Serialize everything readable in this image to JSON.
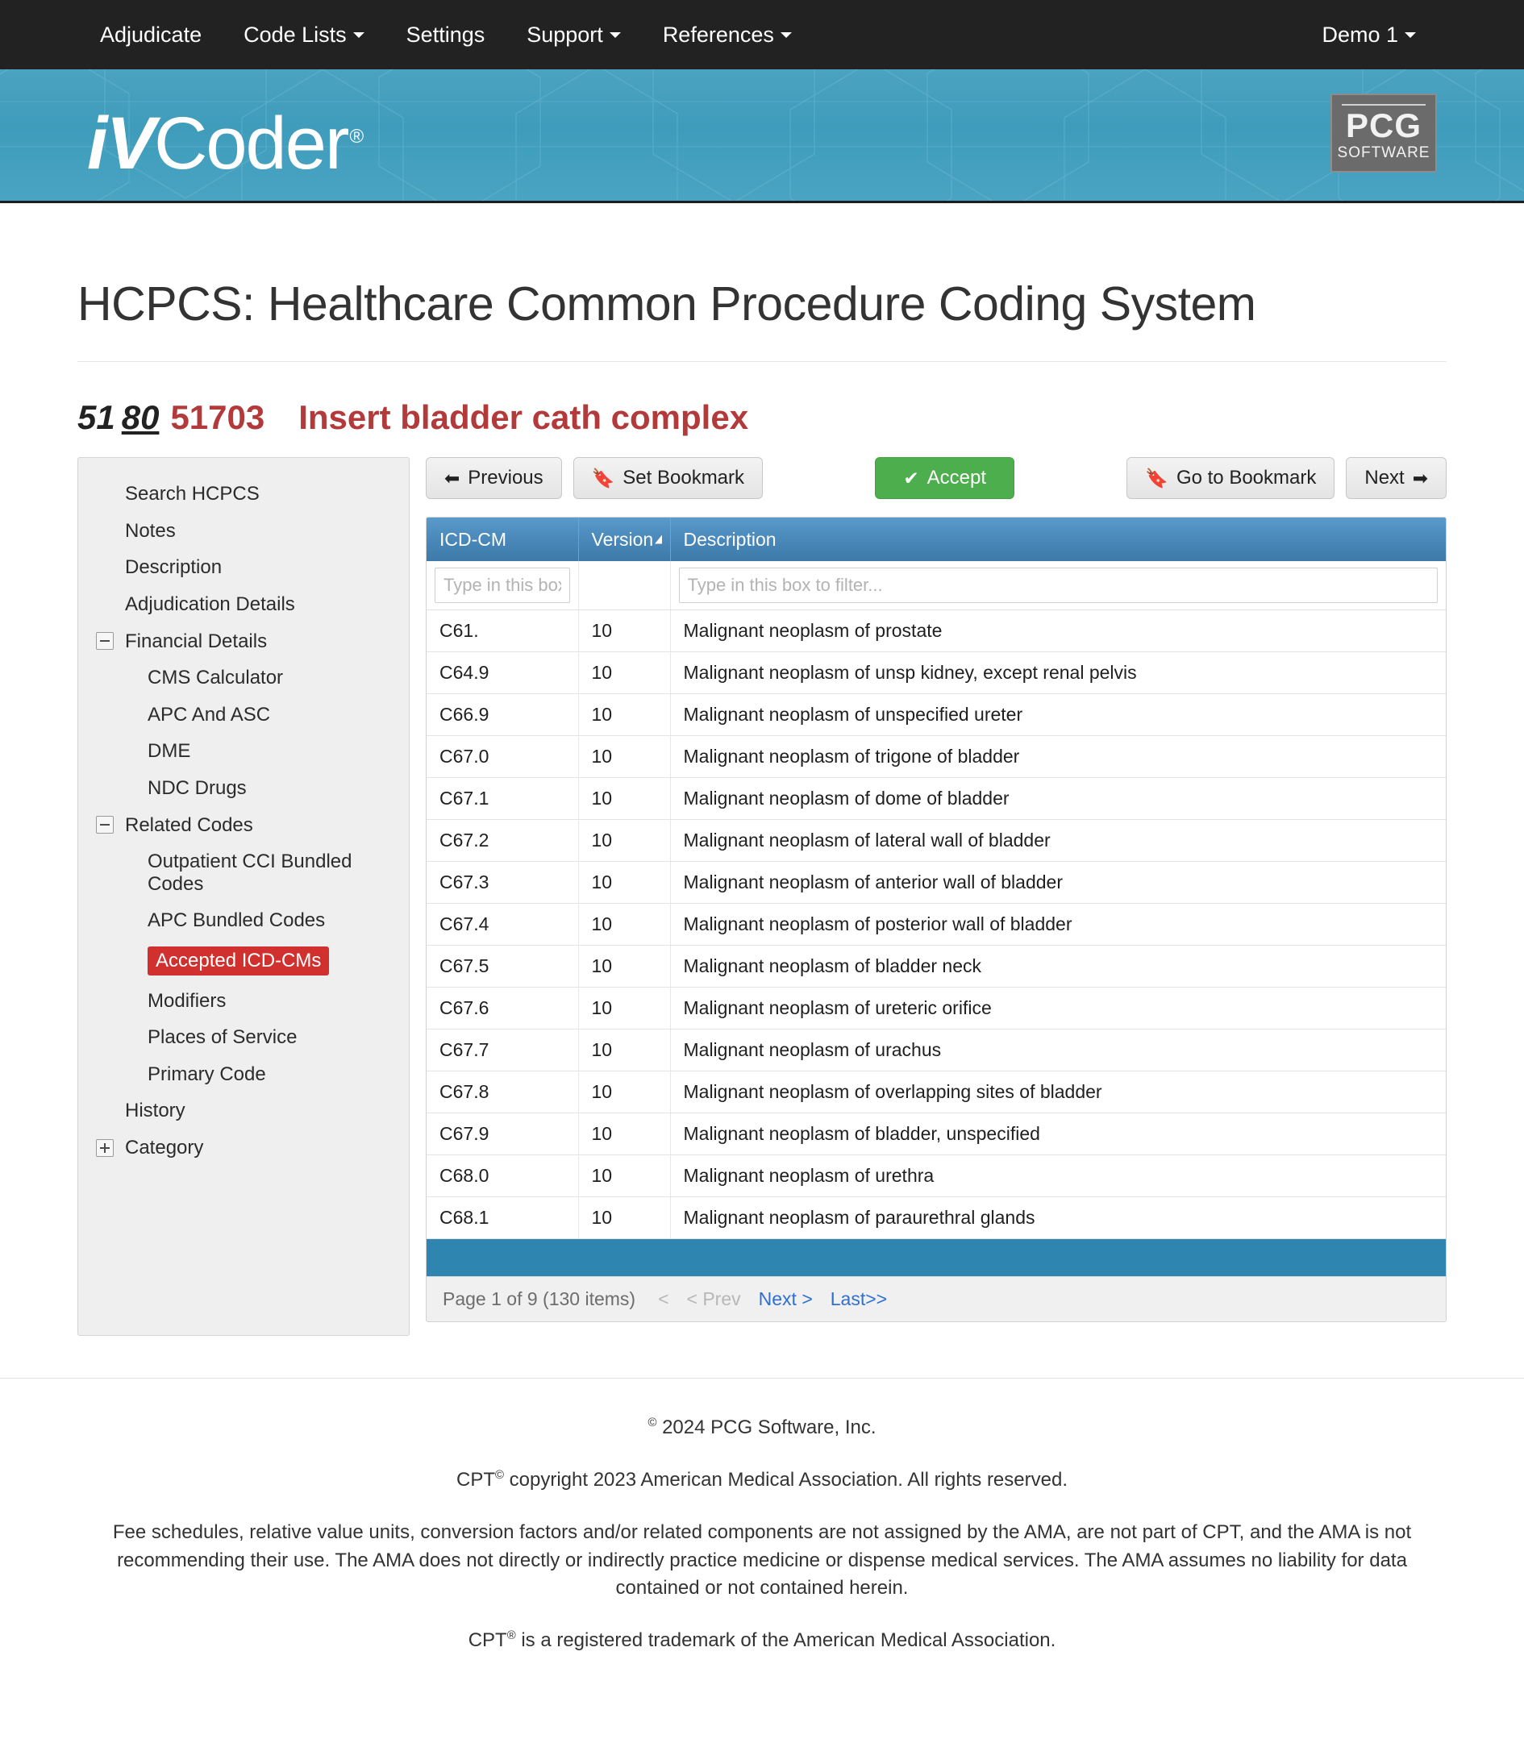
{
  "nav": {
    "items": [
      {
        "label": "Adjudicate",
        "caret": false
      },
      {
        "label": "Code Lists",
        "caret": true
      },
      {
        "label": "Settings",
        "caret": false
      },
      {
        "label": "Support",
        "caret": true
      },
      {
        "label": "References",
        "caret": true
      }
    ],
    "user": {
      "label": "Demo 1",
      "caret": true
    }
  },
  "brand": {
    "logo_i": "i",
    "logo_v": "V",
    "logo_rest": "Coder",
    "registered": "®",
    "pcg_main": "PCG",
    "pcg_sub": "SOFTWARE"
  },
  "page": {
    "title": "HCPCS: Healthcare Common Procedure Coding System",
    "code_modifier_1": "51",
    "code_modifier_2": "80",
    "code_number": "51703",
    "code_description": "Insert bladder cath complex"
  },
  "sidebar": {
    "items": [
      {
        "label": "Search HCPCS",
        "level": 0,
        "twisty": "none",
        "active": false
      },
      {
        "label": "Notes",
        "level": 0,
        "twisty": "none",
        "active": false
      },
      {
        "label": "Description",
        "level": 0,
        "twisty": "none",
        "active": false
      },
      {
        "label": "Adjudication Details",
        "level": 0,
        "twisty": "none",
        "active": false
      },
      {
        "label": "Financial Details",
        "level": 0,
        "twisty": "minus",
        "active": false
      },
      {
        "label": "CMS Calculator",
        "level": 1,
        "twisty": "none",
        "active": false
      },
      {
        "label": "APC And ASC",
        "level": 1,
        "twisty": "none",
        "active": false
      },
      {
        "label": "DME",
        "level": 1,
        "twisty": "none",
        "active": false
      },
      {
        "label": "NDC Drugs",
        "level": 1,
        "twisty": "none",
        "active": false
      },
      {
        "label": "Related Codes",
        "level": 0,
        "twisty": "minus",
        "active": false
      },
      {
        "label": "Outpatient CCI Bundled Codes",
        "level": 1,
        "twisty": "none",
        "active": false
      },
      {
        "label": "APC Bundled Codes",
        "level": 1,
        "twisty": "none",
        "active": false
      },
      {
        "label": "Accepted ICD-CMs",
        "level": 1,
        "twisty": "none",
        "active": true
      },
      {
        "label": "Modifiers",
        "level": 1,
        "twisty": "none",
        "active": false
      },
      {
        "label": "Places of Service",
        "level": 1,
        "twisty": "none",
        "active": false
      },
      {
        "label": "Primary Code",
        "level": 1,
        "twisty": "none",
        "active": false
      },
      {
        "label": "History",
        "level": 0,
        "twisty": "none",
        "active": false
      },
      {
        "label": "Category",
        "level": 0,
        "twisty": "plus",
        "active": false
      }
    ]
  },
  "toolbar": {
    "previous_label": "Previous",
    "previous_icon": "arrow-left-icon",
    "set_bookmark_label": "Set Bookmark",
    "set_bookmark_icon": "bookmark-icon",
    "accept_label": "Accept",
    "accept_icon": "check-icon",
    "go_to_bookmark_label": "Go to Bookmark",
    "go_to_bookmark_icon": "bookmark-flag-icon",
    "next_label": "Next",
    "next_icon": "arrow-right-icon",
    "accept_color": "#4cae4c"
  },
  "grid": {
    "columns": [
      {
        "label": "ICD-CM",
        "sorted": false
      },
      {
        "label": "Version",
        "sorted": true
      },
      {
        "label": "Description",
        "sorted": false
      }
    ],
    "filters": {
      "icd_placeholder": "Type in this box",
      "version_placeholder": "",
      "description_placeholder": "Type in this box to filter..."
    },
    "rows": [
      {
        "code": "C61.",
        "version": "10",
        "description": "Malignant neoplasm of prostate"
      },
      {
        "code": "C64.9",
        "version": "10",
        "description": "Malignant neoplasm of unsp kidney, except renal pelvis"
      },
      {
        "code": "C66.9",
        "version": "10",
        "description": "Malignant neoplasm of unspecified ureter"
      },
      {
        "code": "C67.0",
        "version": "10",
        "description": "Malignant neoplasm of trigone of bladder"
      },
      {
        "code": "C67.1",
        "version": "10",
        "description": "Malignant neoplasm of dome of bladder"
      },
      {
        "code": "C67.2",
        "version": "10",
        "description": "Malignant neoplasm of lateral wall of bladder"
      },
      {
        "code": "C67.3",
        "version": "10",
        "description": "Malignant neoplasm of anterior wall of bladder"
      },
      {
        "code": "C67.4",
        "version": "10",
        "description": "Malignant neoplasm of posterior wall of bladder"
      },
      {
        "code": "C67.5",
        "version": "10",
        "description": "Malignant neoplasm of bladder neck"
      },
      {
        "code": "C67.6",
        "version": "10",
        "description": "Malignant neoplasm of ureteric orifice"
      },
      {
        "code": "C67.7",
        "version": "10",
        "description": "Malignant neoplasm of urachus"
      },
      {
        "code": "C67.8",
        "version": "10",
        "description": "Malignant neoplasm of overlapping sites of bladder"
      },
      {
        "code": "C67.9",
        "version": "10",
        "description": "Malignant neoplasm of bladder, unspecified"
      },
      {
        "code": "C68.0",
        "version": "10",
        "description": "Malignant neoplasm of urethra"
      },
      {
        "code": "C68.1",
        "version": "10",
        "description": "Malignant neoplasm of paraurethral glands"
      }
    ],
    "pager": {
      "status": "Page 1 of 9 (130 items)",
      "first_label": "<",
      "prev_label": "< Prev",
      "next_label": "Next >",
      "last_label": "Last>>",
      "first_disabled": true,
      "prev_disabled": true
    }
  },
  "footer": {
    "copyright_pre": "©",
    "copyright": " 2024 PCG Software, Inc.",
    "cpt_copyright_pre": "CPT",
    "cpt_copyright_sup": "©",
    "cpt_copyright_post": " copyright 2023 American Medical Association. All rights reserved.",
    "disclaimer": "Fee schedules, relative value units, conversion factors and/or related components are not assigned by the AMA, are not part of CPT, and the AMA is not recommending their use. The AMA does not directly or indirectly practice medicine or dispense medical services. The AMA assumes no liability for data contained or not contained herein.",
    "trademark_pre": "CPT",
    "trademark_sup": "®",
    "trademark_post": " is a registered trademark of the American Medical Association."
  },
  "colors": {
    "navbar_bg": "#222222",
    "banner_blue": "#44a0bd",
    "accent_orange": "#e89a2b",
    "active_red": "#d0302e",
    "code_red": "#b33a3a",
    "grid_header_blue": "#4887b8",
    "grid_footer_blue": "#2e86b0",
    "link_blue": "#2f6fd0"
  }
}
